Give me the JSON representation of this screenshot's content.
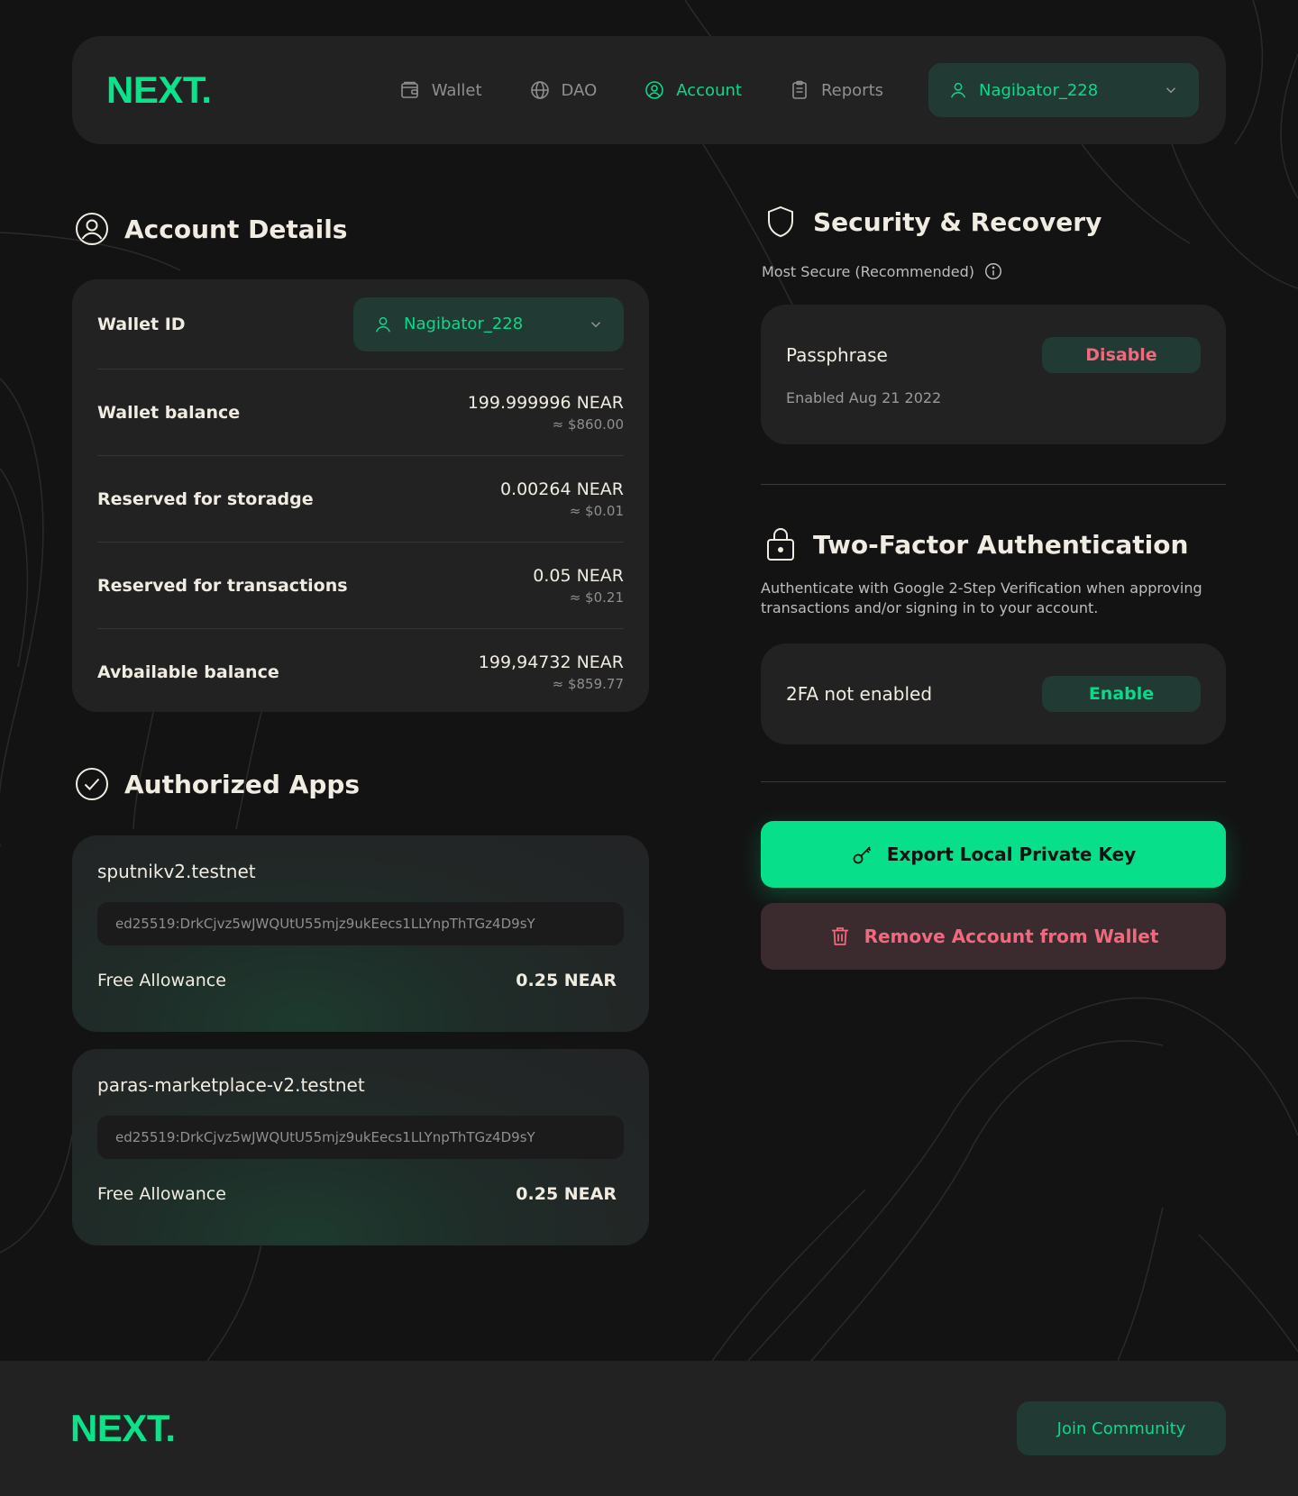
{
  "brand": {
    "logo_text": "NEXT."
  },
  "nav": {
    "items": [
      {
        "label": "Wallet",
        "icon": "wallet-icon",
        "active": false
      },
      {
        "label": "DAO",
        "icon": "globe-icon",
        "active": false
      },
      {
        "label": "Account",
        "icon": "user-circle-icon",
        "active": true
      },
      {
        "label": "Reports",
        "icon": "clipboard-icon",
        "active": false
      }
    ],
    "user": "Nagibator_228"
  },
  "account_details": {
    "title": "Account Details",
    "wallet_id_label": "Wallet ID",
    "wallet_id_value": "Nagibator_228",
    "rows": [
      {
        "label": "Wallet balance",
        "near": "199.999996 NEAR",
        "usd": "≈ $860.00"
      },
      {
        "label": "Reserved for storadge",
        "near": "0.00264 NEAR",
        "usd": "≈ $0.01"
      },
      {
        "label": "Reserved for transactions",
        "near": "0.05 NEAR",
        "usd": "≈ $0.21"
      },
      {
        "label": "Avbailable balance",
        "near": "199,94732 NEAR",
        "usd": "≈ $859.77"
      }
    ]
  },
  "authorized_apps": {
    "title": "Authorized Apps",
    "apps": [
      {
        "name": "sputnikv2.testnet",
        "key": "ed25519:DrkCjvz5wJWQUtU55mjz9ukEecs1LLYnpThTGz4D9sY",
        "allowance_label": "Free Allowance",
        "allowance_value": "0.25 NEAR"
      },
      {
        "name": "paras-marketplace-v2.testnet",
        "key": "ed25519:DrkCjvz5wJWQUtU55mjz9ukEecs1LLYnpThTGz4D9sY",
        "allowance_label": "Free Allowance",
        "allowance_value": "0.25 NEAR"
      }
    ]
  },
  "security": {
    "title": "Security & Recovery",
    "subtitle": "Most Secure (Recommended)",
    "passphrase_label": "Passphrase",
    "passphrase_status": "Enabled Aug 21 2022",
    "disable_label": "Disable"
  },
  "two_factor": {
    "title": "Two-Factor Authentication",
    "description": "Authenticate with Google 2-Step Verification when approving transactions and/or signing in to your account.",
    "status": "2FA not enabled",
    "enable_label": "Enable"
  },
  "actions": {
    "export_label": "Export Local Private Key",
    "remove_label": "Remove Account from Wallet"
  },
  "footer": {
    "logo_text": "NEXT.",
    "join_label": "Join Community"
  },
  "colors": {
    "accent": "#0be38a",
    "danger": "#f0697e",
    "bg": "#131313",
    "card": "#222222"
  }
}
